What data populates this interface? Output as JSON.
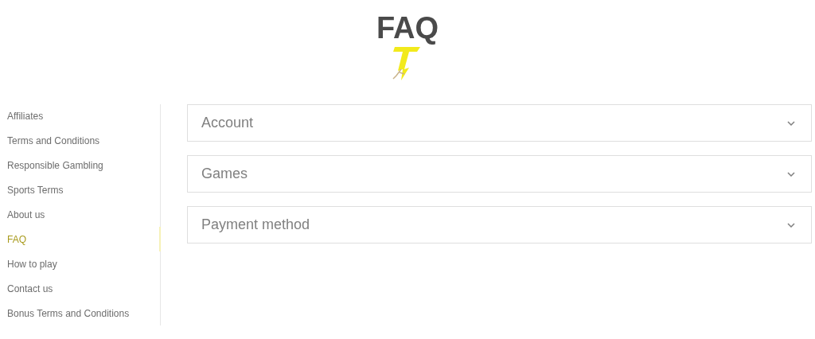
{
  "page_title": "FAQ",
  "sidebar": {
    "items": [
      {
        "label": "Affiliates",
        "selected": false
      },
      {
        "label": "Terms and Conditions",
        "selected": false
      },
      {
        "label": "Responsible Gambling",
        "selected": false
      },
      {
        "label": "Sports Terms",
        "selected": false
      },
      {
        "label": "About us",
        "selected": false
      },
      {
        "label": "FAQ",
        "selected": true
      },
      {
        "label": "How to play",
        "selected": false
      },
      {
        "label": "Contact us",
        "selected": false
      },
      {
        "label": "Bonus Terms and Conditions",
        "selected": false
      }
    ]
  },
  "accordion": [
    {
      "title": "Account",
      "expanded": false
    },
    {
      "title": "Games",
      "expanded": false
    },
    {
      "title": "Payment method",
      "expanded": false
    }
  ]
}
